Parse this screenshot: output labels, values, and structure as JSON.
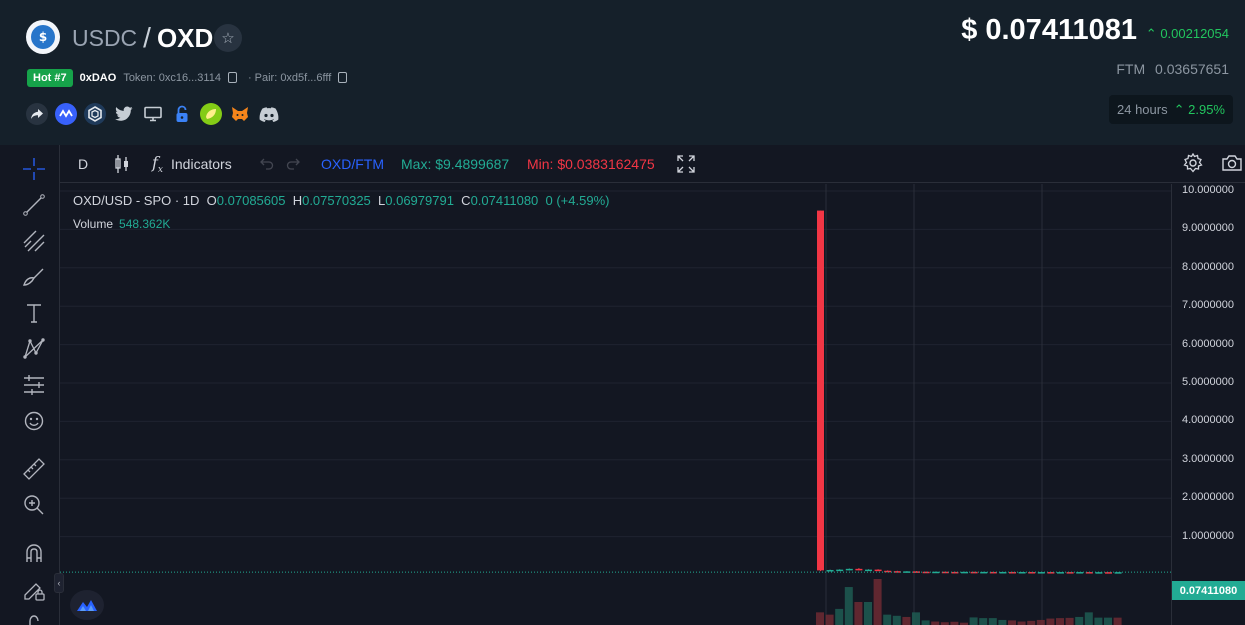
{
  "header": {
    "quote_symbol": "USDC",
    "separator": "/",
    "base_symbol": "OXD",
    "hot_badge": "Hot #7",
    "project_name": "0xDAO",
    "token_label": "Token: 0xc16...3114",
    "pair_label": "Pair: 0xd5f...6fff",
    "price": "$ 0.07411081",
    "price_change": "0.00212054",
    "ftm_label": "FTM",
    "ftm_value": "0.03657651",
    "period_label": "24 hours",
    "period_change": "2.95%",
    "social_icons": [
      "share-icon",
      "coinmarketcap-icon",
      "coingecko-icon",
      "twitter-icon",
      "website-icon",
      "lock-icon",
      "lime-coin-icon",
      "metamask-icon",
      "discord-icon"
    ]
  },
  "toolbar": {
    "interval": "D",
    "indicators_label": "Indicators",
    "quote_pair": "OXD/FTM",
    "max_label": "Max: $9.4899687",
    "min_label": "Min: $0.0383162475"
  },
  "legend": {
    "symbol": "OXD/USD - SPO · 1D",
    "o_label": "O",
    "o_value": "0.07085605",
    "h_label": "H",
    "h_value": "0.07570325",
    "l_label": "L",
    "l_value": "0.06979791",
    "c_label": "C",
    "c_value": "0.07411080",
    "change": "0 (+4.59%)",
    "volume_label": "Volume",
    "volume_value": "548.362K"
  },
  "y_axis": {
    "ticks": [
      "10.000000",
      "9.0000000",
      "8.0000000",
      "7.0000000",
      "6.0000000",
      "5.0000000",
      "4.0000000",
      "3.0000000",
      "2.0000000",
      "1.0000000"
    ],
    "last_price": "0.07411080"
  },
  "colors": {
    "up": "#22ab94",
    "down": "#f23645",
    "background": "#131722",
    "header_bg": "#15202a"
  },
  "chart_data": {
    "type": "candlestick",
    "ylim": [
      0,
      10.5
    ],
    "candles": [
      {
        "o": 9.49,
        "c": 0.12,
        "h": 9.49,
        "l": 0.1
      },
      {
        "o": 0.12,
        "c": 0.13,
        "h": 0.14,
        "l": 0.1
      },
      {
        "o": 0.12,
        "c": 0.14,
        "h": 0.15,
        "l": 0.11
      },
      {
        "o": 0.13,
        "c": 0.16,
        "h": 0.17,
        "l": 0.12
      },
      {
        "o": 0.16,
        "c": 0.13,
        "h": 0.18,
        "l": 0.12
      },
      {
        "o": 0.13,
        "c": 0.14,
        "h": 0.15,
        "l": 0.12
      },
      {
        "o": 0.14,
        "c": 0.11,
        "h": 0.15,
        "l": 0.1
      },
      {
        "o": 0.11,
        "c": 0.1,
        "h": 0.12,
        "l": 0.09
      },
      {
        "o": 0.1,
        "c": 0.09,
        "h": 0.11,
        "l": 0.08
      },
      {
        "o": 0.09,
        "c": 0.095,
        "h": 0.1,
        "l": 0.085
      },
      {
        "o": 0.095,
        "c": 0.085,
        "h": 0.1,
        "l": 0.08
      },
      {
        "o": 0.085,
        "c": 0.08,
        "h": 0.09,
        "l": 0.075
      },
      {
        "o": 0.08,
        "c": 0.085,
        "h": 0.09,
        "l": 0.075
      },
      {
        "o": 0.085,
        "c": 0.08,
        "h": 0.09,
        "l": 0.075
      },
      {
        "o": 0.08,
        "c": 0.078,
        "h": 0.085,
        "l": 0.074
      },
      {
        "o": 0.078,
        "c": 0.082,
        "h": 0.086,
        "l": 0.074
      },
      {
        "o": 0.082,
        "c": 0.079,
        "h": 0.085,
        "l": 0.075
      },
      {
        "o": 0.079,
        "c": 0.08,
        "h": 0.084,
        "l": 0.075
      },
      {
        "o": 0.08,
        "c": 0.077,
        "h": 0.083,
        "l": 0.073
      },
      {
        "o": 0.077,
        "c": 0.079,
        "h": 0.082,
        "l": 0.073
      },
      {
        "o": 0.079,
        "c": 0.076,
        "h": 0.081,
        "l": 0.072
      },
      {
        "o": 0.076,
        "c": 0.078,
        "h": 0.08,
        "l": 0.072
      },
      {
        "o": 0.078,
        "c": 0.075,
        "h": 0.08,
        "l": 0.071
      },
      {
        "o": 0.075,
        "c": 0.077,
        "h": 0.079,
        "l": 0.072
      },
      {
        "o": 0.077,
        "c": 0.074,
        "h": 0.079,
        "l": 0.07
      },
      {
        "o": 0.074,
        "c": 0.076,
        "h": 0.078,
        "l": 0.07
      },
      {
        "o": 0.076,
        "c": 0.075,
        "h": 0.078,
        "l": 0.071
      },
      {
        "o": 0.075,
        "c": 0.077,
        "h": 0.079,
        "l": 0.071
      },
      {
        "o": 0.077,
        "c": 0.076,
        "h": 0.079,
        "l": 0.072
      },
      {
        "o": 0.071,
        "c": 0.074,
        "h": 0.076,
        "l": 0.07
      },
      {
        "o": 0.074,
        "c": 0.073,
        "h": 0.076,
        "l": 0.07
      },
      {
        "o": 0.073,
        "c": 0.0741,
        "h": 0.0757,
        "l": 0.0698
      }
    ],
    "volume": [
      {
        "v": 0.55,
        "dir": "down"
      },
      {
        "v": 0.45,
        "dir": "down"
      },
      {
        "v": 0.7,
        "dir": "up"
      },
      {
        "v": 1.65,
        "dir": "up"
      },
      {
        "v": 1.0,
        "dir": "down"
      },
      {
        "v": 1.0,
        "dir": "up"
      },
      {
        "v": 2.0,
        "dir": "down"
      },
      {
        "v": 0.45,
        "dir": "up"
      },
      {
        "v": 0.4,
        "dir": "up"
      },
      {
        "v": 0.35,
        "dir": "down"
      },
      {
        "v": 0.55,
        "dir": "up"
      },
      {
        "v": 0.2,
        "dir": "up"
      },
      {
        "v": 0.15,
        "dir": "down"
      },
      {
        "v": 0.12,
        "dir": "down"
      },
      {
        "v": 0.14,
        "dir": "down"
      },
      {
        "v": 0.1,
        "dir": "down"
      },
      {
        "v": 0.33,
        "dir": "up"
      },
      {
        "v": 0.3,
        "dir": "up"
      },
      {
        "v": 0.3,
        "dir": "up"
      },
      {
        "v": 0.22,
        "dir": "up"
      },
      {
        "v": 0.2,
        "dir": "down"
      },
      {
        "v": 0.15,
        "dir": "down"
      },
      {
        "v": 0.18,
        "dir": "down"
      },
      {
        "v": 0.22,
        "dir": "down"
      },
      {
        "v": 0.28,
        "dir": "down"
      },
      {
        "v": 0.3,
        "dir": "down"
      },
      {
        "v": 0.31,
        "dir": "down"
      },
      {
        "v": 0.35,
        "dir": "up"
      },
      {
        "v": 0.55,
        "dir": "up"
      },
      {
        "v": 0.32,
        "dir": "up"
      },
      {
        "v": 0.32,
        "dir": "up"
      },
      {
        "v": 0.32,
        "dir": "down"
      }
    ]
  }
}
